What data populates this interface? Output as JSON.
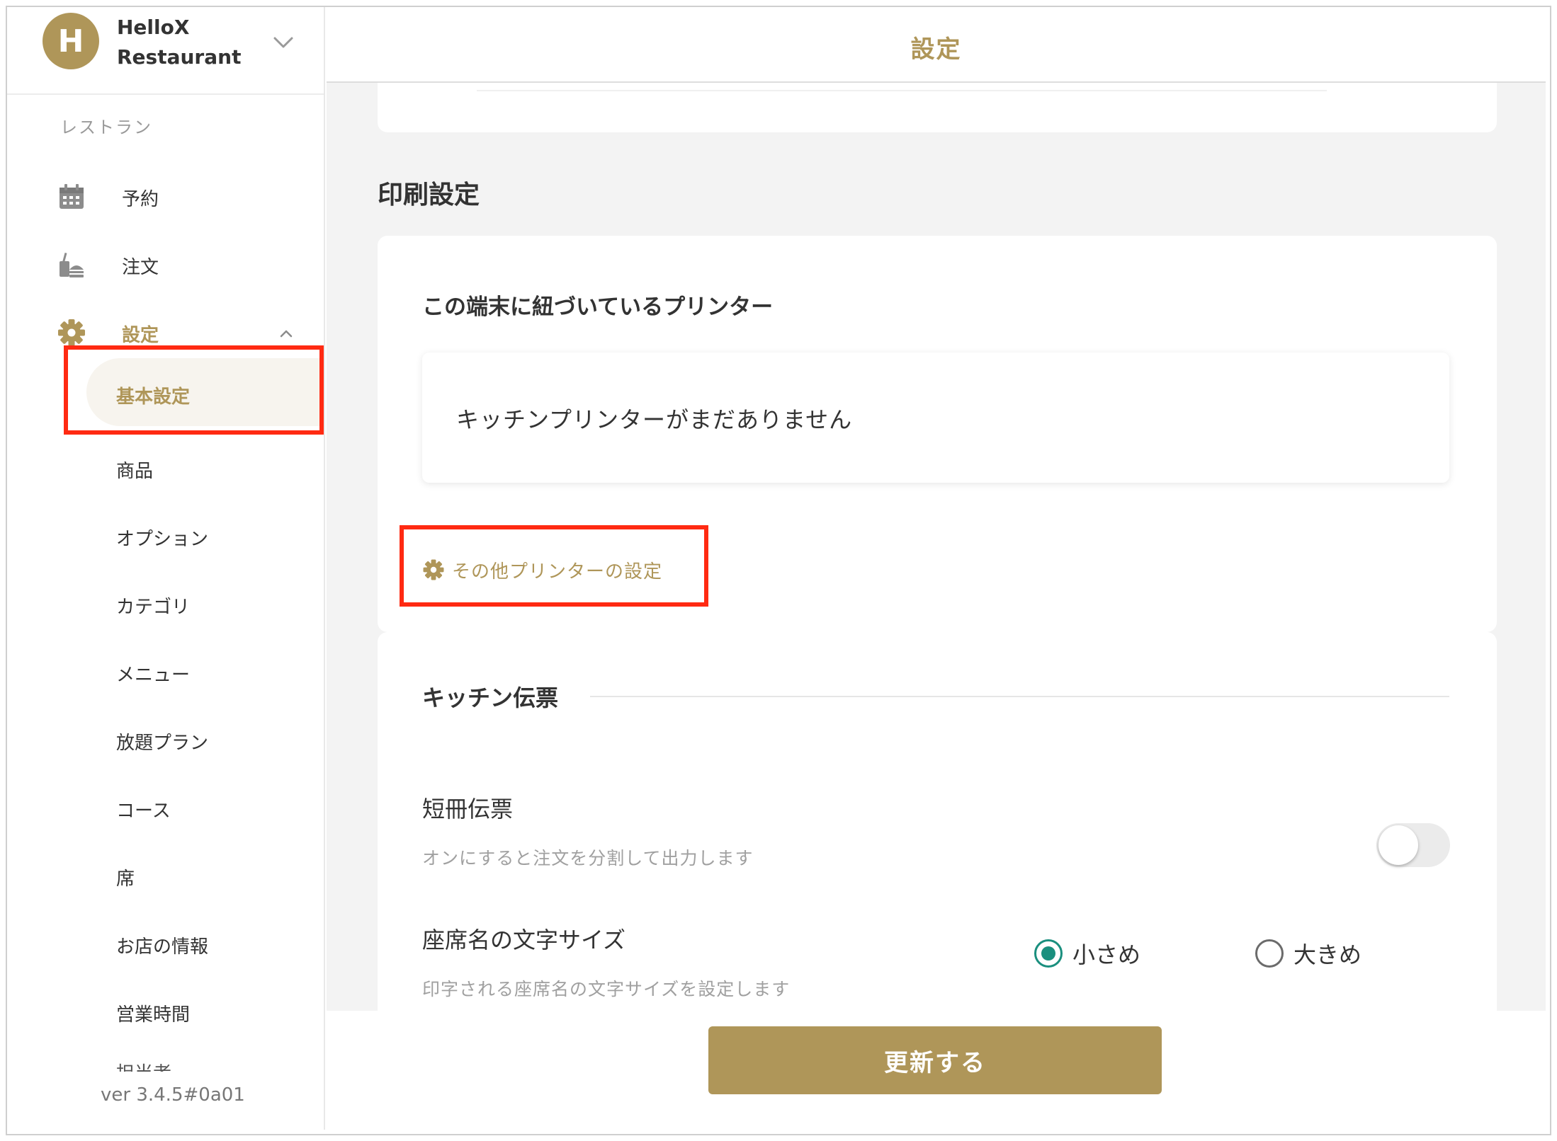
{
  "sidebar": {
    "avatar_initial": "H",
    "restaurant_name": "HelloX Restaurant",
    "section_label": "レストラン",
    "nav": {
      "reservation": "予約",
      "order": "注文",
      "settings": "設定"
    },
    "sub_items": [
      "基本設定",
      "商品",
      "オプション",
      "カテゴリ",
      "メニュー",
      "放題プラン",
      "コース",
      "席",
      "お店の情報",
      "営業時間"
    ],
    "clipped_item": "担当者",
    "version": "ver 3.4.5#0a01"
  },
  "header": {
    "title": "設定"
  },
  "print_settings": {
    "heading": "印刷設定",
    "printer_title": "この端末に紐づいているプリンター",
    "empty_message": "キッチンプリンターがまだありません",
    "other_printer_link": "その他プリンターの設定"
  },
  "kitchen_slip": {
    "title": "キッチン伝票",
    "strip_slip": {
      "title": "短冊伝票",
      "description": "オンにすると注文を分割して出力します",
      "enabled": false
    },
    "seat_font_size": {
      "title": "座席名の文字サイズ",
      "description": "印字される座席名の文字サイズを設定します",
      "options": [
        "小さめ",
        "大きめ"
      ],
      "selected": "小さめ"
    }
  },
  "footer": {
    "update_label": "更新する"
  },
  "colors": {
    "accent": "#af9659",
    "radio_checked": "#1a8f7e",
    "highlight": "#ff2a12"
  }
}
